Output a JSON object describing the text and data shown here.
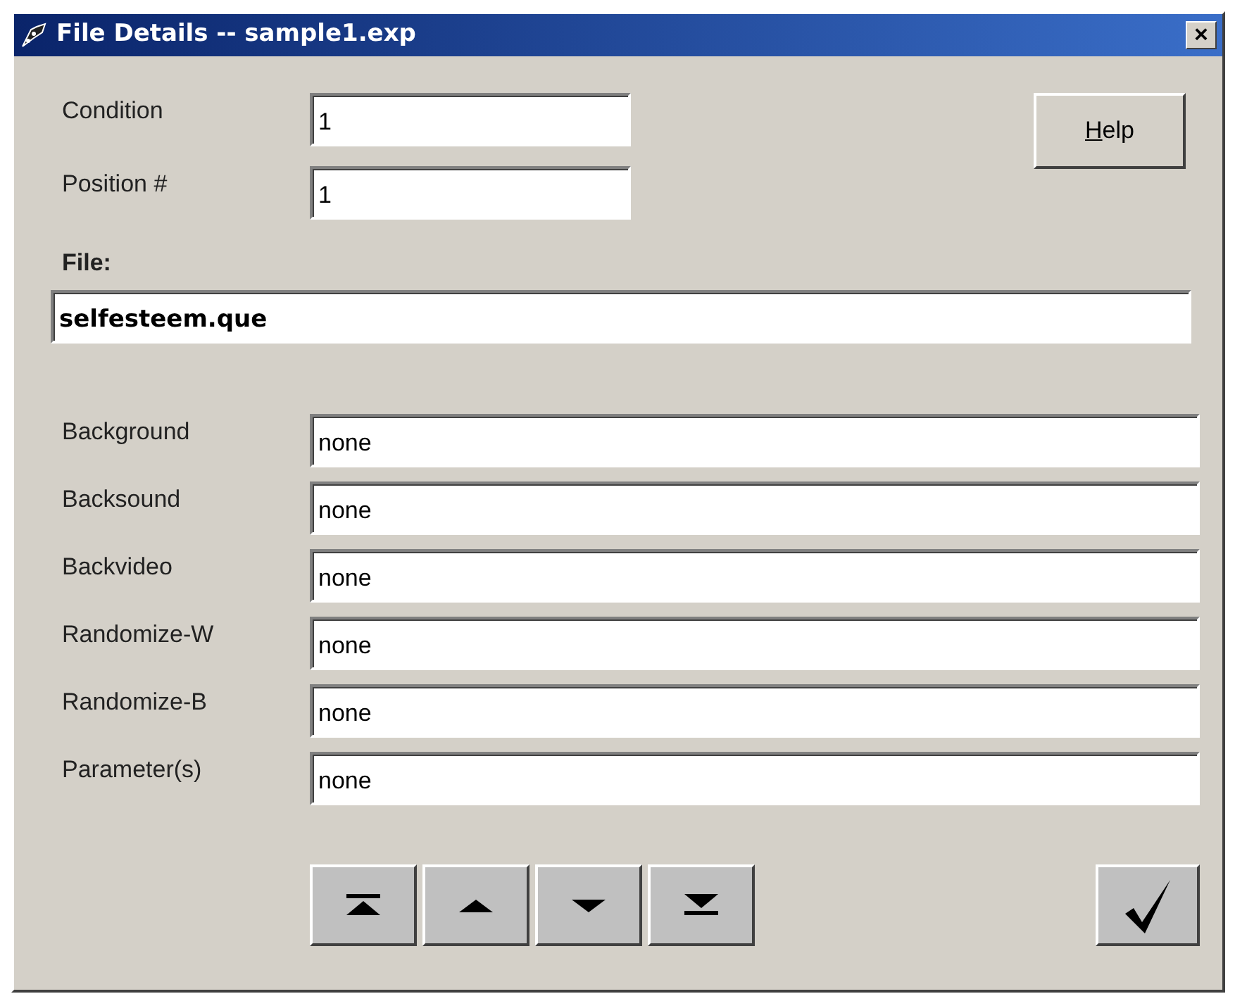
{
  "window": {
    "title": "File Details -- sample1.exp",
    "close": "×"
  },
  "top_fields": [
    {
      "label": "Condition",
      "value": "1"
    },
    {
      "label": "Position #",
      "value": "1"
    }
  ],
  "help_button": {
    "label": "Help",
    "underline_first": true
  },
  "file": {
    "label": "File:",
    "value": "selfesteem.que"
  },
  "fields": [
    {
      "label": "Background",
      "value": "none"
    },
    {
      "label": "Backsound",
      "value": "none"
    },
    {
      "label": "Backvideo",
      "value": "none"
    },
    {
      "label": "Randomize-W",
      "value": "none"
    },
    {
      "label": "Randomize-B",
      "value": "none"
    },
    {
      "label": "Parameter(s)",
      "value": "none"
    }
  ],
  "nav_buttons": [
    {
      "kind": "first"
    },
    {
      "kind": "up"
    },
    {
      "kind": "down"
    },
    {
      "kind": "last"
    }
  ]
}
